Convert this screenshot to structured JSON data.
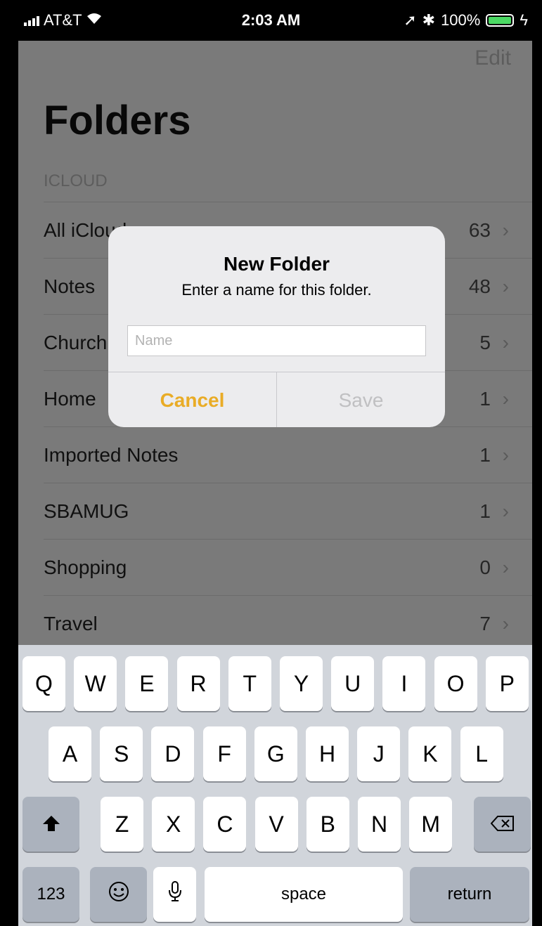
{
  "status_bar": {
    "carrier": "AT&T",
    "time": "2:03 AM",
    "battery": "100%"
  },
  "nav": {
    "edit": "Edit"
  },
  "page": {
    "title": "Folders",
    "section": "ICLOUD",
    "folders": [
      {
        "name": "All iCloud",
        "count": "63"
      },
      {
        "name": "Notes",
        "count": "48"
      },
      {
        "name": "Church",
        "count": "5"
      },
      {
        "name": "Home",
        "count": "1"
      },
      {
        "name": "Imported Notes",
        "count": "1"
      },
      {
        "name": "SBAMUG",
        "count": "1"
      },
      {
        "name": "Shopping",
        "count": "0"
      },
      {
        "name": "Travel",
        "count": "7"
      }
    ]
  },
  "alert": {
    "title": "New Folder",
    "message": "Enter a name for this folder.",
    "field_placeholder": "Name",
    "field_value": "",
    "cancel": "Cancel",
    "save": "Save"
  },
  "keyboard": {
    "row1": [
      "Q",
      "W",
      "E",
      "R",
      "T",
      "Y",
      "U",
      "I",
      "O",
      "P"
    ],
    "row2": [
      "A",
      "S",
      "D",
      "F",
      "G",
      "H",
      "J",
      "K",
      "L"
    ],
    "row3": [
      "Z",
      "X",
      "C",
      "V",
      "B",
      "N",
      "M"
    ],
    "numbers": "123",
    "space": "space",
    "return": "return"
  },
  "colors": {
    "accent": "#e9ac26",
    "battery": "#4cd964"
  }
}
